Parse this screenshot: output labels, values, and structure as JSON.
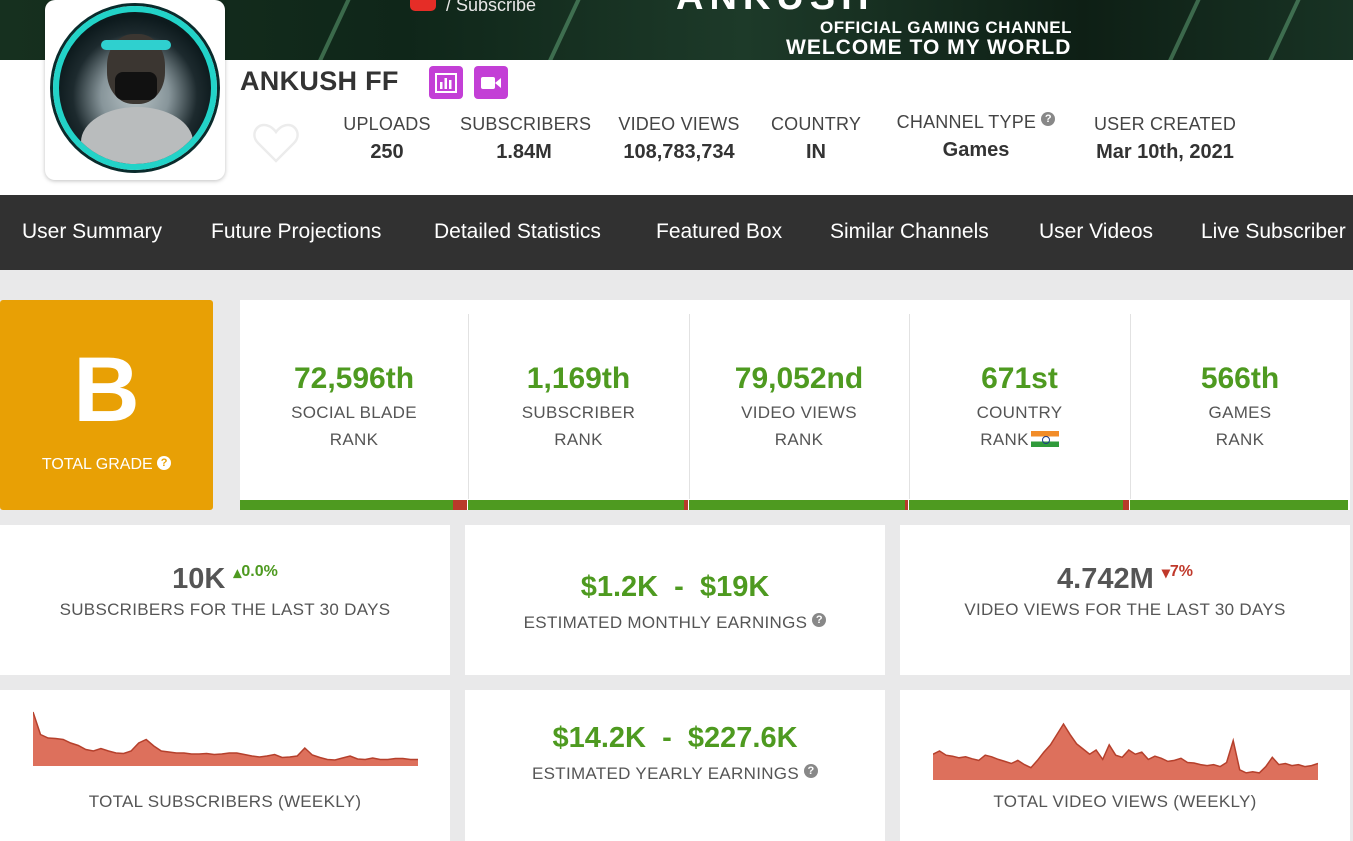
{
  "banner": {
    "subscribe_label": "/ Subscribe",
    "channel_logo_text": "ANKUSH",
    "tagline": "OFFICIAL GAMING CHANNEL",
    "welcome": "WELCOME TO MY WORLD"
  },
  "channel": {
    "name": "ANKUSH FF",
    "stats": [
      {
        "label": "UPLOADS",
        "value": "250"
      },
      {
        "label": "SUBSCRIBERS",
        "value": "1.84M"
      },
      {
        "label": "VIDEO VIEWS",
        "value": "108,783,734"
      },
      {
        "label": "COUNTRY",
        "value": "IN"
      },
      {
        "label": "CHANNEL TYPE",
        "value": "Games"
      },
      {
        "label": "USER CREATED",
        "value": "Mar 10th, 2021"
      }
    ]
  },
  "nav": {
    "tabs": [
      "User Summary",
      "Future Projections",
      "Detailed Statistics",
      "Featured Box",
      "Similar Channels",
      "User Videos",
      "Live Subscriber"
    ]
  },
  "grade": {
    "letter": "B",
    "caption": "TOTAL GRADE",
    "color": "#e8a005"
  },
  "ranks": [
    {
      "value": "72,596th",
      "line1": "SOCIAL BLADE",
      "line2": "RANK",
      "fill": 0.94
    },
    {
      "value": "1,169th",
      "line1": "SUBSCRIBER",
      "line2": "RANK",
      "fill": 0.99
    },
    {
      "value": "79,052nd",
      "line1": "VIDEO VIEWS",
      "line2": "RANK",
      "fill": 0.99
    },
    {
      "value": "671st",
      "line1": "COUNTRY",
      "line2": "RANK",
      "fill": 0.97
    },
    {
      "value": "566th",
      "line1": "GAMES",
      "line2": "RANK",
      "fill": 1.0
    }
  ],
  "summary": {
    "subs_30": {
      "value": "10K",
      "delta": "0.0%",
      "caption": "SUBSCRIBERS FOR THE LAST 30 DAYS"
    },
    "monthly": {
      "value": "$1.2K  -  $19K",
      "caption": "ESTIMATED MONTHLY EARNINGS"
    },
    "views_30": {
      "value": "4.742M",
      "delta": "7%",
      "caption": "VIDEO VIEWS FOR THE LAST 30 DAYS"
    },
    "yearly": {
      "value": "$14.2K  -  $227.6K",
      "caption": "ESTIMATED YEARLY EARNINGS"
    },
    "subs_chart_caption": "TOTAL SUBSCRIBERS (WEEKLY)",
    "views_chart_caption": "TOTAL VIDEO VIEWS (WEEKLY)"
  },
  "colors": {
    "accent_green": "#4e9a20",
    "nav_bg": "#313131",
    "badge_purple": "#c33fd6",
    "chart_fill": "#d9604a"
  },
  "sparklines": {
    "subscribers": [
      1.0,
      0.55,
      0.48,
      0.47,
      0.45,
      0.38,
      0.33,
      0.25,
      0.22,
      0.27,
      0.22,
      0.18,
      0.17,
      0.22,
      0.38,
      0.45,
      0.32,
      0.22,
      0.2,
      0.18,
      0.18,
      0.16,
      0.16,
      0.17,
      0.15,
      0.16,
      0.18,
      0.18,
      0.15,
      0.12,
      0.1,
      0.12,
      0.15,
      0.09,
      0.1,
      0.12,
      0.28,
      0.14,
      0.09,
      0.05,
      0.04,
      0.08,
      0.12,
      0.06,
      0.05,
      0.08,
      0.05,
      0.05,
      0.07,
      0.07,
      0.05,
      0.05
    ],
    "views": [
      0.42,
      0.48,
      0.4,
      0.38,
      0.35,
      0.37,
      0.33,
      0.3,
      0.4,
      0.37,
      0.32,
      0.28,
      0.24,
      0.3,
      0.22,
      0.16,
      0.3,
      0.46,
      0.6,
      0.8,
      1.0,
      0.8,
      0.62,
      0.52,
      0.42,
      0.5,
      0.32,
      0.6,
      0.4,
      0.36,
      0.5,
      0.42,
      0.46,
      0.32,
      0.38,
      0.34,
      0.28,
      0.3,
      0.34,
      0.26,
      0.25,
      0.22,
      0.2,
      0.22,
      0.18,
      0.26,
      0.68,
      0.12,
      0.06,
      0.08,
      0.06,
      0.18,
      0.36,
      0.22,
      0.24,
      0.2,
      0.22,
      0.18,
      0.2,
      0.24
    ]
  }
}
